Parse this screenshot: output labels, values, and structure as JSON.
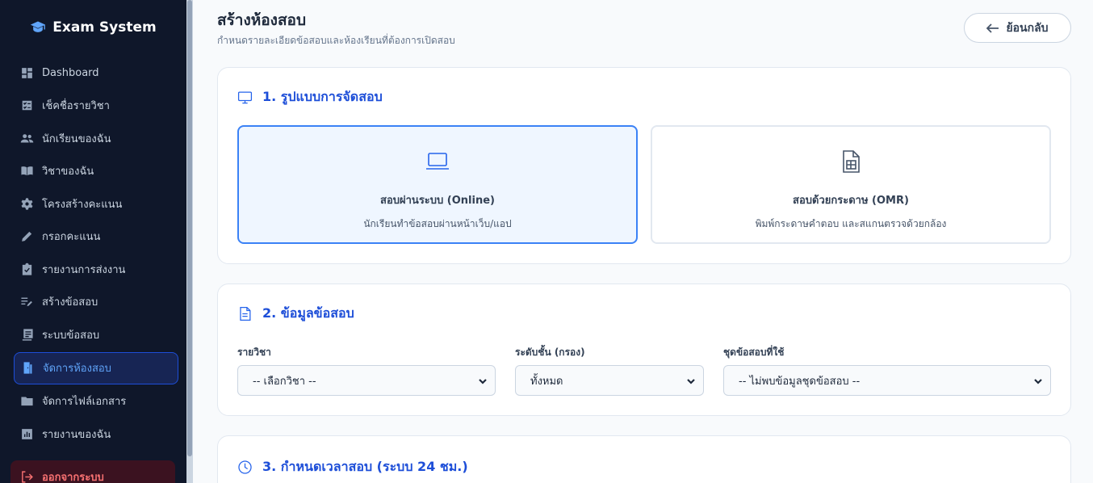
{
  "sidebar": {
    "brand": "Exam System",
    "items": [
      {
        "label": "Dashboard",
        "icon": "dashboard-icon"
      },
      {
        "label": "เช็คชื่อรายวิชา",
        "icon": "checklist-icon"
      },
      {
        "label": "นักเรียนของฉัน",
        "icon": "people-icon"
      },
      {
        "label": "วิชาของฉัน",
        "icon": "book-icon"
      },
      {
        "label": "โครงสร้างคะแนน",
        "icon": "gear-icon"
      },
      {
        "label": "กรอกคะแนน",
        "icon": "pencil-icon"
      },
      {
        "label": "รายงานการส่งงาน",
        "icon": "clipboard-check-icon"
      },
      {
        "label": "สร้างข้อสอบ",
        "icon": "edit-list-icon"
      },
      {
        "label": "ระบบข้อสอบ",
        "icon": "library-icon"
      },
      {
        "label": "จัดการห้องสอบ",
        "icon": "door-icon",
        "active": true
      },
      {
        "label": "จัดการไฟล์เอกสาร",
        "icon": "folder-icon"
      },
      {
        "label": "รายงานของฉัน",
        "icon": "report-icon"
      }
    ],
    "logout": "ออกจากระบบ"
  },
  "header": {
    "title": "สร้างห้องสอบ",
    "subtitle": "กำหนดรายละเอียดข้อสอบและห้องเรียนที่ต้องการเปิดสอบ",
    "back_label": "ย้อนกลับ"
  },
  "section1": {
    "title": "1. รูปแบบการจัดสอบ",
    "online": {
      "title": "สอบผ่านระบบ (Online)",
      "desc": "นักเรียนทำข้อสอบผ่านหน้าเว็บ/แอป",
      "selected": true
    },
    "omr": {
      "title": "สอบด้วยกระดาษ (OMR)",
      "desc": "พิมพ์กระดาษคำตอบ และสแกนตรวจด้วยกล้อง",
      "selected": false
    }
  },
  "section2": {
    "title": "2. ข้อมูลข้อสอบ",
    "subject": {
      "label": "รายวิชา",
      "value": "-- เลือกวิชา --"
    },
    "grade": {
      "label": "ระดับชั้น (กรอง)",
      "value": "ทั้งหมด"
    },
    "exam_set": {
      "label": "ชุดข้อสอบที่ใช้",
      "value": "-- ไม่พบข้อมูลชุดข้อสอบ --"
    }
  },
  "section3": {
    "title": "3. กำหนดเวลาสอบ (ระบบ 24 ชม.)"
  },
  "colors": {
    "sidebar_bg": "#0f172a",
    "accent": "#2563eb",
    "active_text": "#60a5fa",
    "logout": "#f87171"
  }
}
